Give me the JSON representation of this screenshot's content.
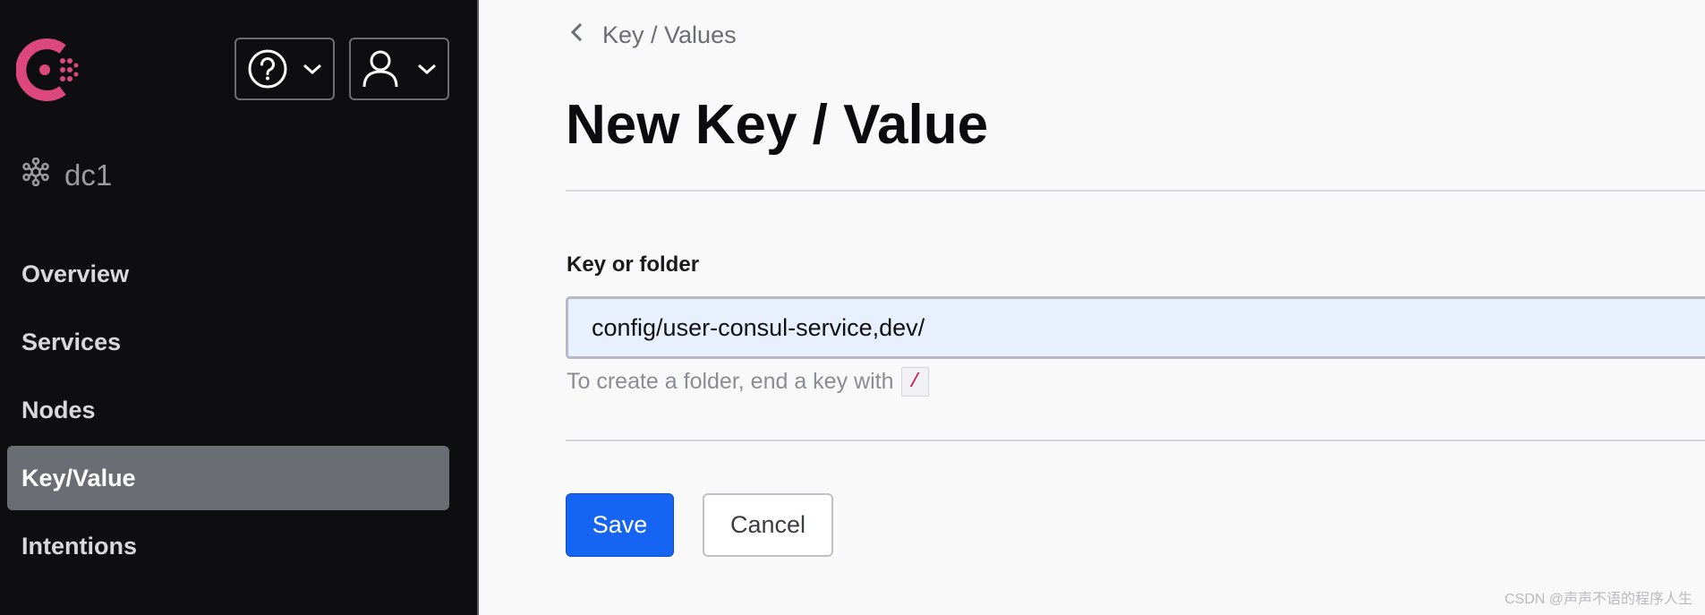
{
  "sidebar": {
    "datacenter": "dc1",
    "items": [
      {
        "label": "Overview",
        "active": false
      },
      {
        "label": "Services",
        "active": false
      },
      {
        "label": "Nodes",
        "active": false
      },
      {
        "label": "Key/Value",
        "active": true
      },
      {
        "label": "Intentions",
        "active": false
      }
    ]
  },
  "header": {
    "help_icon": "help-circle-icon",
    "user_icon": "user-icon"
  },
  "main": {
    "breadcrumb": "Key / Values",
    "title": "New Key / Value",
    "field": {
      "label": "Key or folder",
      "value": "config/user-consul-service,dev/",
      "help": "To create a folder, end a key with",
      "help_code": "/"
    },
    "buttons": {
      "save": "Save",
      "cancel": "Cancel"
    }
  },
  "watermark": "CSDN @声声不语的程序人生",
  "colors": {
    "brand": "#dc477d",
    "primary": "#1664f4",
    "sidebar_bg": "#0e0e10",
    "active_nav": "#6b6d74"
  }
}
